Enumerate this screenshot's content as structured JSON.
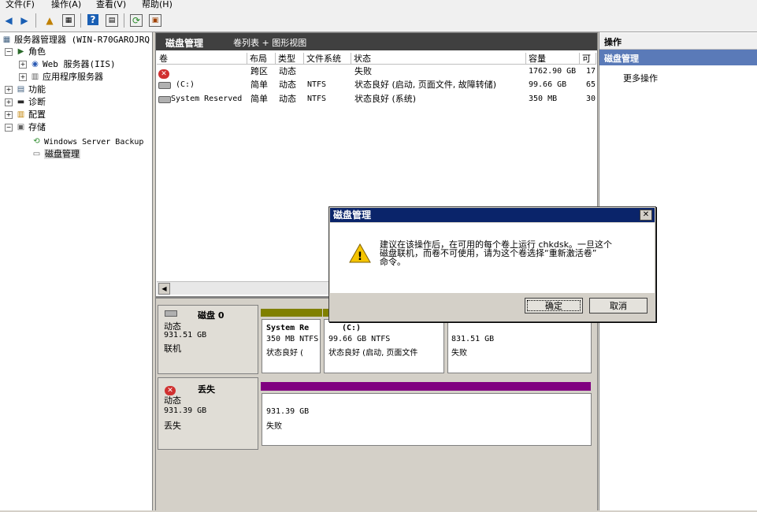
{
  "menu": [
    "文件(F)",
    "操作(A)",
    "查看(V)",
    "帮助(H)"
  ],
  "tree": {
    "root": "服务器管理器 (WIN-R70GAROJRQ",
    "items": [
      "角色",
      "Web 服务器(IIS)",
      "应用程序服务器",
      "功能",
      "诊断",
      "配置",
      "存储",
      "Windows Server Backup",
      "磁盘管理"
    ]
  },
  "center": {
    "title": "磁盘管理",
    "view": "卷列表 + 图形视图",
    "columns": [
      "卷",
      "布局",
      "类型",
      "文件系统",
      "状态",
      "容量",
      "可"
    ],
    "rows": [
      {
        "volume": "",
        "layout": "跨区",
        "type": "动态",
        "fs": "",
        "status": "失败",
        "capacity": "1762.90 GB",
        "free": "17"
      },
      {
        "volume": "(C:)",
        "layout": "简单",
        "type": "动态",
        "fs": "NTFS",
        "status": "状态良好 (启动, 页面文件, 故障转储)",
        "capacity": "99.66 GB",
        "free": "65"
      },
      {
        "volume": "System Reserved",
        "layout": "简单",
        "type": "动态",
        "fs": "NTFS",
        "status": "状态良好 (系统)",
        "capacity": "350 MB",
        "free": "30"
      }
    ]
  },
  "disks": [
    {
      "name": "磁盘 0",
      "type": "动态",
      "size": "931.51 GB",
      "state": "联机",
      "partitions": [
        {
          "label": "System Re",
          "size": "350 MB NTFS",
          "status": "状态良好 (",
          "color": "#808000"
        },
        {
          "label": "(C:)",
          "size": "99.66 GB NTFS",
          "status": "状态良好 (启动, 页面文件",
          "color": "#808000"
        },
        {
          "label": "",
          "size": "831.51 GB",
          "status": "失败",
          "color": "#800080"
        }
      ]
    },
    {
      "name": "丢失",
      "type": "动态",
      "size": "931.39 GB",
      "state": "丢失",
      "partitions": [
        {
          "label": "",
          "size": "931.39 GB",
          "status": "失败",
          "color": "#800080"
        }
      ]
    }
  ],
  "actions": {
    "header": "操作",
    "section": "磁盘管理",
    "more": "更多操作"
  },
  "dialog": {
    "title": "磁盘管理",
    "line1": "建议在该操作后，在可用的每个卷上运行 chkdsk。一旦这个",
    "line2": "磁盘联机，而卷不可使用，请为这个卷选择“重新激活卷”",
    "line3": "命令。",
    "ok": "确定",
    "cancel": "取消"
  }
}
